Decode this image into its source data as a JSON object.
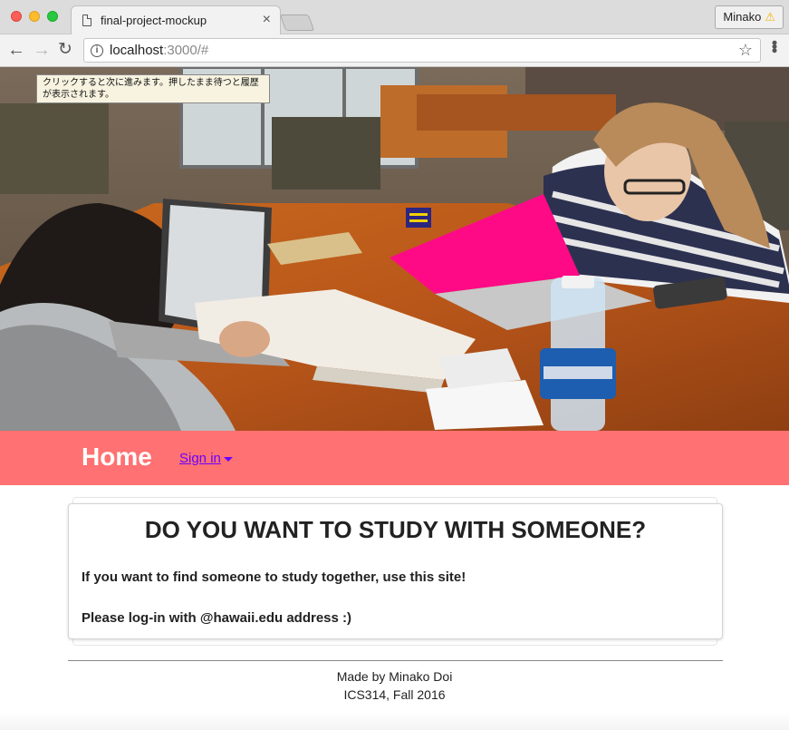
{
  "browser": {
    "tab_title": "final-project-mockup",
    "tab_close": "×",
    "profile_name": "Minako",
    "url_host": "localhost",
    "url_rest": ":3000/#",
    "info_icon": "i",
    "star_icon": "☆",
    "back_icon": "←",
    "forward_icon": "→",
    "reload_icon": "↻"
  },
  "tooltip": {
    "text": "クリックすると次に進みます。押したまま待つと履歴が表示されます。"
  },
  "hero": {
    "image": "students-studying-photo"
  },
  "navbar": {
    "brand": "Home",
    "signin_label": "Sign in",
    "background": "#ff7172"
  },
  "card": {
    "heading": "DO YOU WANT TO STUDY WITH SOMEONE?",
    "line1": "If you want to find someone to study together, use this site!",
    "line2": "Please log-in with @hawaii.edu address :)"
  },
  "footer": {
    "line1": "Made by Minako Doi",
    "line2": "ICS314, Fall 2016"
  }
}
